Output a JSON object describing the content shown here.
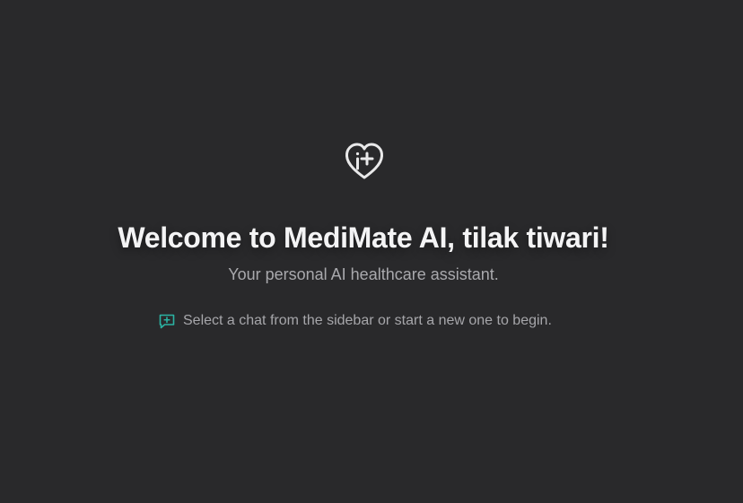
{
  "welcome": {
    "logo_icon": "heart-info-plus-icon",
    "title": "Welcome to MediMate AI, tilak tiwari!",
    "subtitle": "Your personal AI healthcare assistant.",
    "hint_icon": "message-plus-icon",
    "hint_text": "Select a chat from the sidebar or start a new one to begin."
  },
  "colors": {
    "background": "#29292b",
    "title": "#f4f4f5",
    "muted_text": "#a9a9ad",
    "accent": "#2bb3a3"
  }
}
